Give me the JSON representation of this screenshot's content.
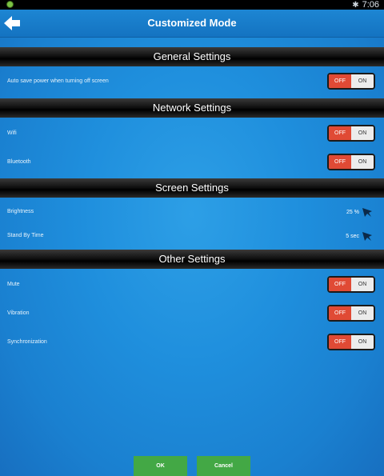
{
  "status_bar": {
    "time": "7:06",
    "bluetooth_icon": "bluetooth-icon",
    "app_icon": "green-dot-icon"
  },
  "header": {
    "title": "Customized Mode",
    "back_icon": "back-arrow-icon"
  },
  "sections": {
    "general": {
      "title": "General Settings",
      "items": [
        {
          "label": "Auto save power when turning off screen",
          "off_label": "OFF",
          "on_label": "ON",
          "state": "off"
        }
      ]
    },
    "network": {
      "title": "Network Settings",
      "items": [
        {
          "label": "Wifi",
          "off_label": "OFF",
          "on_label": "ON",
          "state": "off"
        },
        {
          "label": "Bluetooth",
          "off_label": "OFF",
          "on_label": "ON",
          "state": "off"
        }
      ]
    },
    "screen": {
      "title": "Screen Settings",
      "items": [
        {
          "label": "Brightness",
          "value": "25 %"
        },
        {
          "label": "Stand By Time",
          "value": "5 sec"
        }
      ]
    },
    "other": {
      "title": "Other Settings",
      "items": [
        {
          "label": "Mute",
          "off_label": "OFF",
          "on_label": "ON",
          "state": "off"
        },
        {
          "label": "Vibration",
          "off_label": "OFF",
          "on_label": "ON",
          "state": "off"
        },
        {
          "label": "Synchronization",
          "off_label": "OFF",
          "on_label": "ON",
          "state": "off"
        }
      ]
    }
  },
  "buttons": {
    "ok": "OK",
    "cancel": "Cancel"
  },
  "colors": {
    "background": "#1f8fdd",
    "section_header": "#000000",
    "toggle_off": "#e04a35",
    "button_green": "#43a845"
  }
}
